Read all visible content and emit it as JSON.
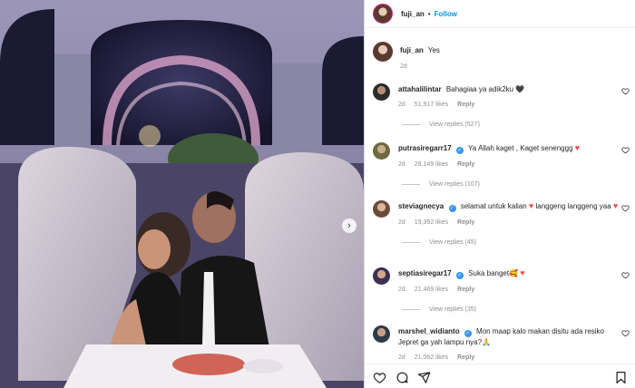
{
  "post": {
    "username": "fuji_an",
    "follow_label": "Follow",
    "separator": "•",
    "caption": "Yes",
    "caption_age": "2d"
  },
  "comments": [
    {
      "username": "attahalilintar",
      "verified": false,
      "text": "Bahagiaa ya adik2ku 🖤",
      "age": "2d",
      "likes": "51,917 likes",
      "reply": "Reply",
      "view_replies": "View replies (527)"
    },
    {
      "username": "putrasiregarr17",
      "verified": true,
      "text": "Ya Allah kaget , Kaget senenggg",
      "age": "2d",
      "likes": "28,149 likes",
      "reply": "Reply",
      "view_replies": "View replies (107)"
    },
    {
      "username": "steviagnecya",
      "verified": true,
      "text": "selamat untuk kalian",
      "text2": "langgeng langgeng yaa",
      "age": "2d",
      "likes": "19,392 likes",
      "reply": "Reply",
      "view_replies": "View replies (45)"
    },
    {
      "username": "septiasiregar17",
      "verified": true,
      "text": "Suka banget🥰",
      "age": "2d",
      "likes": "21,469 likes",
      "reply": "Reply",
      "view_replies": "View replies (35)"
    },
    {
      "username": "marshel_widianto",
      "verified": true,
      "text": "Mon maap kalo makan disitu ada resiko Jepret ga yah lampu nya?🙏",
      "age": "2d",
      "likes": "21,062 likes",
      "reply": "Reply"
    }
  ],
  "icons": {
    "heart": "heart-icon",
    "comment": "comment-icon",
    "share": "share-icon",
    "save": "bookmark-icon",
    "next": "chevron-right-icon",
    "verified": "verified-badge-icon"
  },
  "glyphs": {
    "verified_mark": "✓",
    "next_arrow": "›",
    "red_heart": "♥"
  },
  "colors": {
    "link": "#0095f6",
    "muted": "#8e8e8e",
    "verified": "#3897f0",
    "heart": "#ed4956"
  }
}
